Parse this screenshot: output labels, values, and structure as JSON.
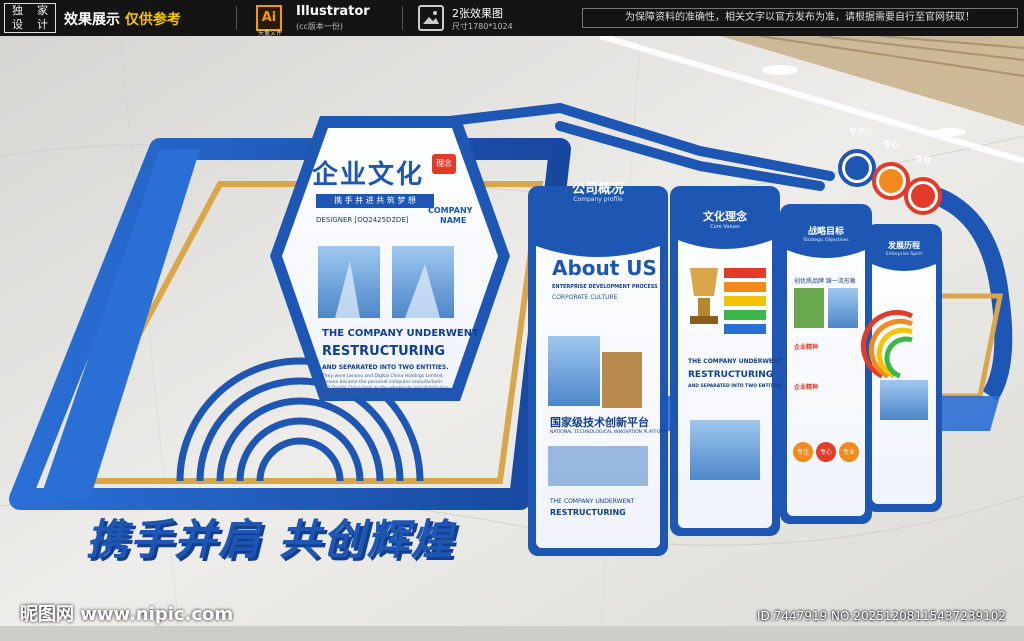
{
  "topbar": {
    "logo_chars": [
      "独",
      "家",
      "设",
      "计"
    ],
    "effect_label": "效果展示",
    "effect_highlight": "仅供参考",
    "ai_badge": "Ai",
    "ai_sub": "矢量文件",
    "app_name": "Illustrator",
    "app_version": "(cc版本一份)",
    "image_count": "2张效果图",
    "image_size": "尺寸1780*1024",
    "notice": "为保障资料的准确性，相关文字以官方发布为准，请根据需要自行至官网获取！"
  },
  "hex_panel": {
    "title": "企业文化",
    "tag": "理念",
    "slogan": "携 手 并 进 共 筑 梦 想",
    "company": "COMPANY",
    "name": "NAME",
    "designer": "DESIGNER [OQ2425D2DE]",
    "headline1": "THE COMPANY UNDERWENT",
    "headline2": "RESTRUCTURING",
    "sub": "AND SEPARATED INTO TWO ENTITIES.",
    "body": "They were Lenovo and Digital China Holdings Limited. Lenovo became the personal computer manufacturer and Digital China took on the wholesale and distribution of IT products and services."
  },
  "panels": [
    {
      "title": "公司概况",
      "subtitle": "Company profile",
      "about": "About US",
      "process": "ENTERPRISE DEVELOPMENT PROCESS",
      "culture": "CORPORATE CULTURE",
      "cn_title": "国家级技术创新平台",
      "en_title": "NATIONAL TECHNOLOGICAL INNOVATION PLATFORM",
      "footer1": "THE COMPANY UNDERWENT",
      "footer2": "RESTRUCTURING"
    },
    {
      "title": "文化理念",
      "subtitle": "Core Values",
      "h1": "THE COMPANY UNDERWENT",
      "h2": "RESTRUCTURING",
      "h3": "AND SEPARATED INTO TWO ENTITIES."
    },
    {
      "title": "战略目标",
      "subtitle": "Strategic Objectives",
      "line": "创优质品牌 铸一流形象",
      "b1": "企业精神",
      "b2": "企业精神",
      "badges": [
        "专注",
        "专心",
        "专业"
      ]
    },
    {
      "title": "发展历程",
      "subtitle": "Enterprise Spirit"
    }
  ],
  "top_circles": [
    "专注",
    "专心",
    "专业"
  ],
  "slogan_large": "携手并肩 共创辉煌",
  "watermark": {
    "site": "昵图网 www.nipic.com",
    "id": "ID:7447919 NO:20251208115437239102"
  },
  "colors": {
    "brand_blue": "#1e56b4",
    "deep_blue": "#123f8f",
    "gold": "#d9a64a",
    "orange": "#f28a1e",
    "red": "#e23b2a"
  }
}
